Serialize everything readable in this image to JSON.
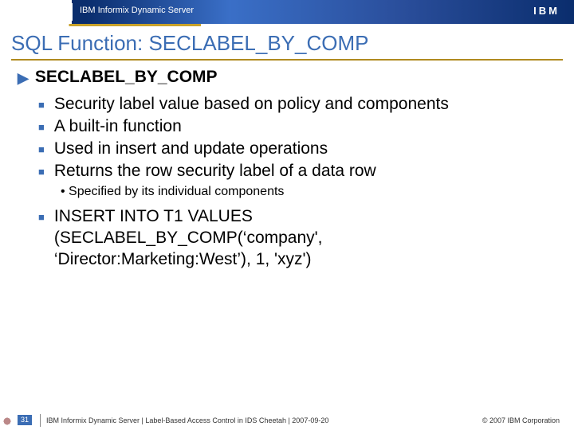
{
  "header": {
    "product": "IBM Informix Dynamic Server",
    "logo": "IBM"
  },
  "title": "SQL Function: SECLABEL_BY_COMP",
  "section_heading": "SECLABEL_BY_COMP",
  "bullets_a": [
    "Security label value based on policy and components",
    "A built-in function",
    "Used in insert and update operations",
    "Returns the row security label of a data row"
  ],
  "subbullets": [
    "Specified by its individual components"
  ],
  "bullets_b": [
    "INSERT INTO T1 VALUES (SECLABEL_BY_COMP(‘company', ‘Director:Marketing:West’), 1, 'xyz')"
  ],
  "footer": {
    "page": "31",
    "text": "IBM Informix Dynamic Server | Label-Based Access Control in IDS Cheetah | 2007-09-20",
    "copyright": "© 2007 IBM Corporation"
  }
}
